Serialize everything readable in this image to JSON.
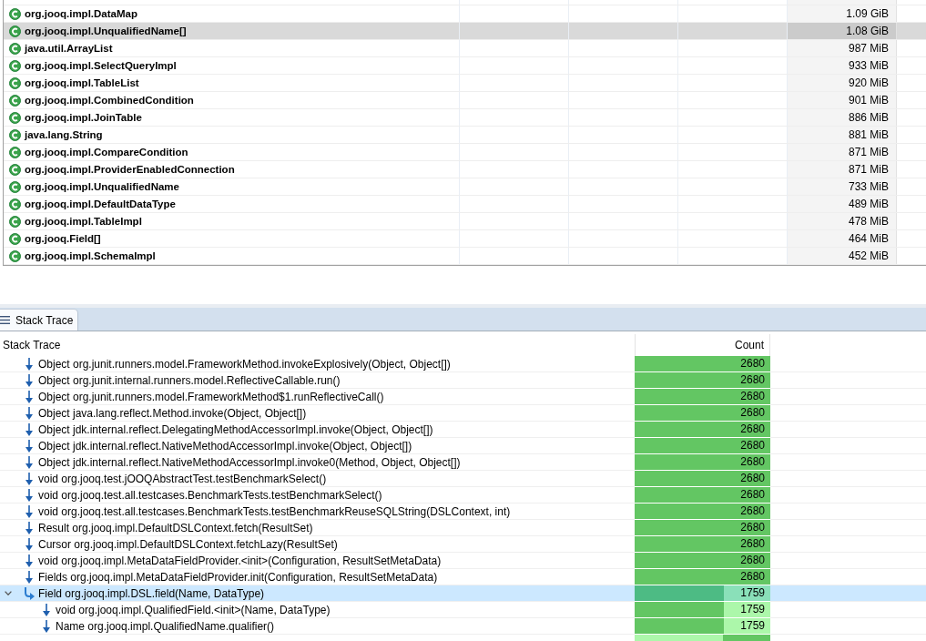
{
  "class_table": {
    "rows": [
      {
        "name": "org.jooq.impl.DataMap",
        "size": "1.09 GiB",
        "selected": false
      },
      {
        "name": "org.jooq.impl.UnqualifiedName[]",
        "size": "1.08 GiB",
        "selected": true
      },
      {
        "name": "java.util.ArrayList",
        "size": "987 MiB",
        "selected": false
      },
      {
        "name": "org.jooq.impl.SelectQueryImpl",
        "size": "933 MiB",
        "selected": false
      },
      {
        "name": "org.jooq.impl.TableList",
        "size": "920 MiB",
        "selected": false
      },
      {
        "name": "org.jooq.impl.CombinedCondition",
        "size": "901 MiB",
        "selected": false
      },
      {
        "name": "org.jooq.impl.JoinTable",
        "size": "886 MiB",
        "selected": false
      },
      {
        "name": "java.lang.String",
        "size": "881 MiB",
        "selected": false
      },
      {
        "name": "org.jooq.impl.CompareCondition",
        "size": "871 MiB",
        "selected": false
      },
      {
        "name": "org.jooq.impl.ProviderEnabledConnection",
        "size": "871 MiB",
        "selected": false
      },
      {
        "name": "org.jooq.impl.UnqualifiedName",
        "size": "733 MiB",
        "selected": false
      },
      {
        "name": "org.jooq.impl.DefaultDataType",
        "size": "489 MiB",
        "selected": false
      },
      {
        "name": "org.jooq.impl.TableImpl",
        "size": "478 MiB",
        "selected": false
      },
      {
        "name": "org.jooq.Field[]",
        "size": "464 MiB",
        "selected": false
      },
      {
        "name": "org.jooq.impl.SchemaImpl",
        "size": "452 MiB",
        "selected": false
      }
    ]
  },
  "stack_trace_view": {
    "tab": {
      "label": "Stack Trace",
      "selected": true
    },
    "columns": [
      "Stack Trace",
      "Count"
    ],
    "rows": [
      {
        "kind": "call",
        "method": "Object org.junit.runners.model.FrameworkMethod.invokeExplosively(Object, Object[])",
        "count": "2680",
        "level": 1,
        "selected": false
      },
      {
        "kind": "call",
        "method": "Object org.junit.internal.runners.model.ReflectiveCallable.run()",
        "count": "2680",
        "level": 1,
        "selected": false
      },
      {
        "kind": "call",
        "method": "Object org.junit.runners.model.FrameworkMethod$1.runReflectiveCall()",
        "count": "2680",
        "level": 1,
        "selected": false
      },
      {
        "kind": "call",
        "method": "Object java.lang.reflect.Method.invoke(Object, Object[])",
        "count": "2680",
        "level": 1,
        "selected": false
      },
      {
        "kind": "call",
        "method": "Object jdk.internal.reflect.DelegatingMethodAccessorImpl.invoke(Object, Object[])",
        "count": "2680",
        "level": 1,
        "selected": false
      },
      {
        "kind": "call",
        "method": "Object jdk.internal.reflect.NativeMethodAccessorImpl.invoke(Object, Object[])",
        "count": "2680",
        "level": 1,
        "selected": false
      },
      {
        "kind": "call",
        "method": "Object jdk.internal.reflect.NativeMethodAccessorImpl.invoke0(Method, Object, Object[])",
        "count": "2680",
        "level": 1,
        "selected": false
      },
      {
        "kind": "call",
        "method": "void org.jooq.test.jOOQAbstractTest.testBenchmarkSelect()",
        "count": "2680",
        "level": 1,
        "selected": false
      },
      {
        "kind": "call",
        "method": "void org.jooq.test.all.testcases.BenchmarkTests.testBenchmarkSelect()",
        "count": "2680",
        "level": 1,
        "selected": false
      },
      {
        "kind": "call",
        "method": "void org.jooq.test.all.testcases.BenchmarkTests.testBenchmarkReuseSQLString(DSLContext, int)",
        "count": "2680",
        "level": 1,
        "selected": false
      },
      {
        "kind": "call",
        "method": "Result org.jooq.impl.DefaultDSLContext.fetch(ResultSet)",
        "count": "2680",
        "level": 1,
        "selected": false
      },
      {
        "kind": "call",
        "method": "Cursor org.jooq.impl.DefaultDSLContext.fetchLazy(ResultSet)",
        "count": "2680",
        "level": 1,
        "selected": false
      },
      {
        "kind": "call",
        "method": "void org.jooq.impl.MetaDataFieldProvider.<init>(Configuration, ResultSetMetaData)",
        "count": "2680",
        "level": 1,
        "selected": false
      },
      {
        "kind": "call",
        "method": "Fields org.jooq.impl.MetaDataFieldProvider.init(Configuration, ResultSetMetaData)",
        "count": "2680",
        "level": 1,
        "selected": false
      },
      {
        "kind": "branch",
        "method": "Field org.jooq.impl.DSL.field(Name, DataType)",
        "count": "1759",
        "level": 0.656,
        "fill_at_end": false,
        "selected": true,
        "expanded": true,
        "children": [
          {
            "kind": "call",
            "method": "void org.jooq.impl.QualifiedField.<init>(Name, DataType)",
            "count": "1759",
            "level": 0.656,
            "fill_at_end": false,
            "selected": false
          },
          {
            "kind": "call",
            "method": "Name org.jooq.impl.QualifiedName.qualifier()",
            "count": "1759",
            "level": 0.656,
            "fill_at_end": false,
            "selected": false
          }
        ]
      },
      {
        "kind": "call",
        "level": 0.35,
        "fill_at_end": true,
        "selected": false
      }
    ]
  }
}
